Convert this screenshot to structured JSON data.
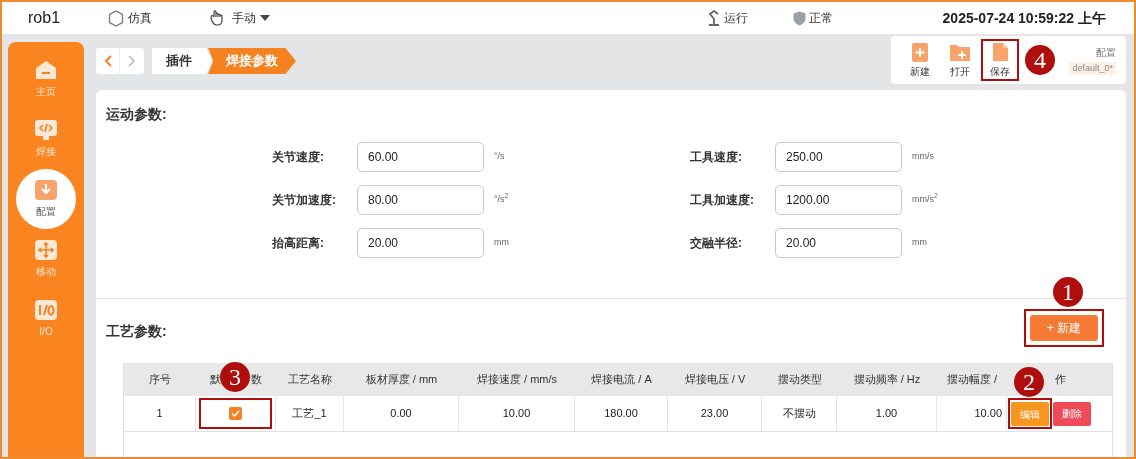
{
  "topbar": {
    "robot": "rob1",
    "mode": "仿真",
    "control": "手动",
    "run_state": "运行",
    "health": "正常",
    "datetime": "2025-07-24 10:59:22 上午"
  },
  "sidebar": [
    {
      "kind": "home",
      "label": "主页",
      "selected": false
    },
    {
      "kind": "code",
      "label": "焊接",
      "selected": false
    },
    {
      "kind": "config",
      "label": "配置",
      "selected": true
    },
    {
      "kind": "move",
      "label": "移动",
      "selected": false
    },
    {
      "kind": "io",
      "label": "I/O",
      "selected": false
    }
  ],
  "breadcrumb": [
    {
      "label": "插件",
      "selected": false
    },
    {
      "label": "焊接参数",
      "selected": true
    }
  ],
  "toolbar": {
    "tools": [
      {
        "kind": "new",
        "label": "新建"
      },
      {
        "kind": "open",
        "label": "打开"
      },
      {
        "kind": "save",
        "label": "保存",
        "callout": "4"
      }
    ],
    "config_label": "配置",
    "config_name": "default_0*"
  },
  "motion": {
    "title": "运动参数:",
    "left": [
      {
        "label": "关节速度:",
        "value": "60.00",
        "unit": "°/s"
      },
      {
        "label": "关节加速度:",
        "value": "80.00",
        "unit": "°/s$^{2}$"
      },
      {
        "label": "抬高距离:",
        "value": "20.00",
        "unit": "mm"
      }
    ],
    "right": [
      {
        "label": "工具速度:",
        "value": "250.00",
        "unit": "mm/s"
      },
      {
        "label": "工具加速度:",
        "value": "1200.00",
        "unit": "mm/s$^{2}$"
      },
      {
        "label": "交融半径:",
        "value": "20.00",
        "unit": "mm"
      }
    ]
  },
  "process": {
    "title": "工艺参数:",
    "new_button": {
      "label": "+ 新建",
      "callout": "1"
    },
    "table": {
      "columns": [
        {
          "parts": [
            "序号"
          ]
        },
        {
          "parts": [
            "默",
            "数"
          ],
          "callout": "3"
        },
        {
          "parts": [
            "工艺名称"
          ]
        },
        {
          "parts": [
            "板材厚度 / mm"
          ]
        },
        {
          "parts": [
            "焊接速度 / mm/s"
          ]
        },
        {
          "parts": [
            "焊接电流 / A"
          ]
        },
        {
          "parts": [
            "焊接电压 / V"
          ]
        },
        {
          "parts": [
            "摆动类型"
          ]
        },
        {
          "parts": [
            "摆动频率 / Hz"
          ]
        },
        {
          "parts": [
            "摆动幅度 /"
          ]
        },
        {
          "parts": [
            "作"
          ],
          "callout": "2"
        }
      ],
      "rows": [
        {
          "index": "1",
          "default": true,
          "name": "工艺_1",
          "thickness": "0.00",
          "speed": "10.00",
          "current": "180.00",
          "voltage": "23.00",
          "swing_type": "不摆动",
          "swing_freq": "1.00",
          "swing_amp": "10.00",
          "edit": "编辑",
          "delete": "删除"
        }
      ]
    }
  }
}
